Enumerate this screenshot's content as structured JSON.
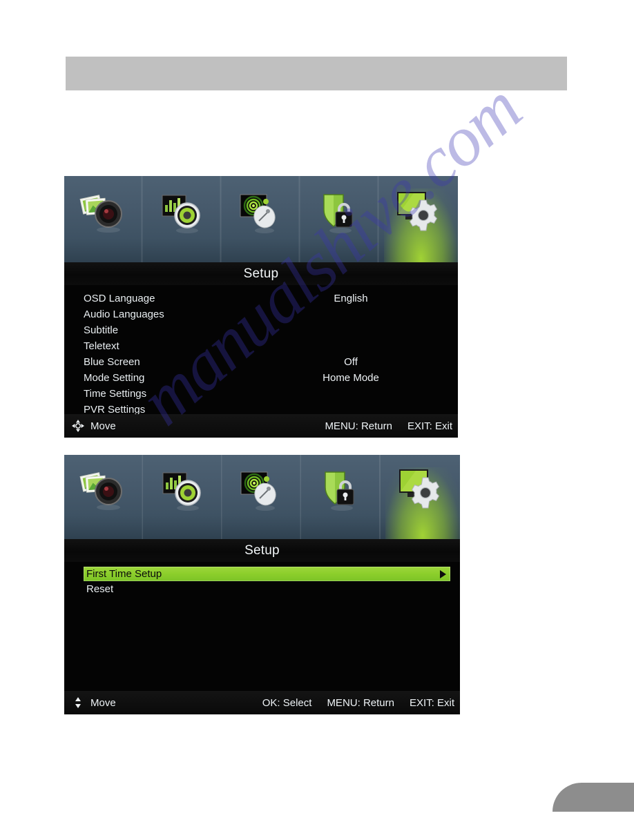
{
  "page": {
    "header_band": "",
    "page_marker": "",
    "watermark_text": "manualshive.com"
  },
  "nav_icons": [
    {
      "name": "picture-icon",
      "label": "Picture"
    },
    {
      "name": "sound-icon",
      "label": "Sound"
    },
    {
      "name": "channel-icon",
      "label": "Channel"
    },
    {
      "name": "lock-icon",
      "label": "Lock"
    },
    {
      "name": "setup-icon",
      "label": "Setup"
    }
  ],
  "panel_one": {
    "title": "Setup",
    "rows": [
      {
        "label": "OSD Language",
        "value": "English"
      },
      {
        "label": "Audio Languages",
        "value": ""
      },
      {
        "label": "Subtitle",
        "value": ""
      },
      {
        "label": "Teletext",
        "value": ""
      },
      {
        "label": "Blue Screen",
        "value": "Off"
      },
      {
        "label": "Mode Setting",
        "value": "Home Mode"
      },
      {
        "label": "Time Settings",
        "value": ""
      },
      {
        "label": "PVR Settings",
        "value": ""
      }
    ],
    "footer": {
      "move_label": "Move",
      "hints": [
        "MENU: Return",
        "EXIT: Exit"
      ]
    }
  },
  "panel_two": {
    "title": "Setup",
    "rows": [
      {
        "label": "First Time Setup",
        "value": "",
        "highlighted": true
      },
      {
        "label": "Reset",
        "value": "",
        "highlighted": false
      }
    ],
    "footer": {
      "move_label": "Move",
      "hints": [
        "OK: Select",
        "MENU: Return",
        "EXIT: Exit"
      ]
    }
  },
  "colors": {
    "highlight_green": "#8cce2b",
    "navbar_blue": "#46596b",
    "panel_black": "#040404",
    "header_gray": "#c0c0c0",
    "watermark_blue": "#3a34b4"
  }
}
